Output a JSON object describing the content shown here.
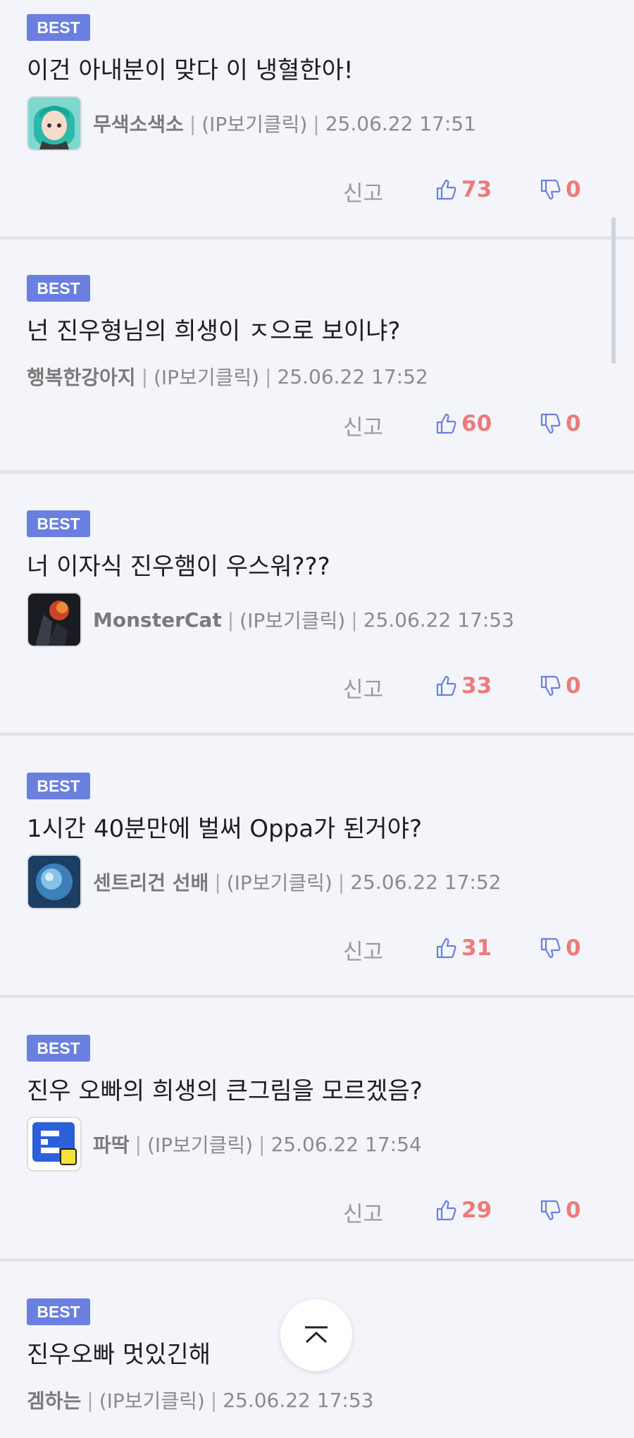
{
  "comments": [
    {
      "badge": "BEST",
      "text": "이건 아내분이 맞다 이 냉혈한아!",
      "nick": "무색소색소",
      "ip_label": "(IP보기클릭)",
      "date": "25.06.22 17:51",
      "report": "신고",
      "likes": "73",
      "dislikes": "0",
      "avatar": "anime-teal-hair-avatar"
    },
    {
      "badge": "BEST",
      "text": "넌 진우형님의 희생이 ㅈ으로 보이냐?",
      "nick": "행복한강아지",
      "ip_label": "(IP보기클릭)",
      "date": "25.06.22 17:52",
      "report": "신고",
      "likes": "60",
      "dislikes": "0",
      "avatar": null
    },
    {
      "badge": "BEST",
      "text": "너 이자식 진우햄이 우스워???",
      "nick": "MonsterCat",
      "ip_label": "(IP보기클릭)",
      "date": "25.06.22 17:53",
      "report": "신고",
      "likes": "33",
      "dislikes": "0",
      "avatar": "dark-fire-avatar"
    },
    {
      "badge": "BEST",
      "text": "1시간 40분만에 벌써 Oppa가 된거야?",
      "nick": "센트리건 선배",
      "ip_label": "(IP보기클릭)",
      "date": "25.06.22 17:52",
      "report": "신고",
      "likes": "31",
      "dislikes": "0",
      "avatar": "blue-water-avatar"
    },
    {
      "badge": "BEST",
      "text": "진우 오빠의 희생의 큰그림을 모르겠음?",
      "nick": "파딱",
      "ip_label": "(IP보기클릭)",
      "date": "25.06.22 17:54",
      "report": "신고",
      "likes": "29",
      "dislikes": "0",
      "avatar": "blue-pixel-badge-avatar"
    },
    {
      "badge": "BEST",
      "text": "진우오빠 멋있긴해",
      "nick": "겜하는",
      "ip_label": "(IP보기클릭)",
      "date": "25.06.22 17:53",
      "report": null,
      "likes": null,
      "dislikes": null,
      "avatar": null
    }
  ],
  "colors": {
    "background": "#f3f5fa",
    "best_badge": "#6a7fe0",
    "vote": "#ef7a7a",
    "muted": "#8b8b8b"
  },
  "icons": {
    "thumbs_up": "thumbs-up-icon",
    "thumbs_down": "thumbs-down-icon",
    "scroll_top": "chevron-up-icon"
  }
}
